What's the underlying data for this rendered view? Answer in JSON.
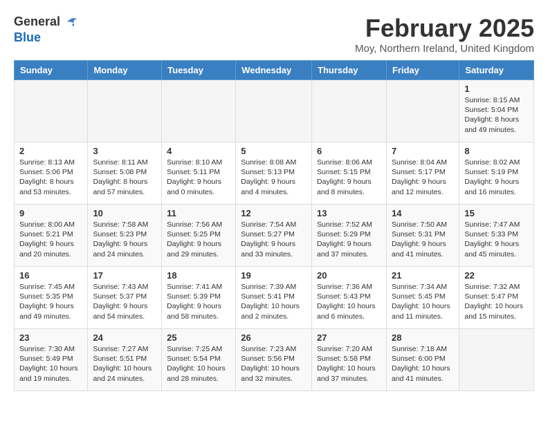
{
  "logo": {
    "general": "General",
    "blue": "Blue"
  },
  "title": "February 2025",
  "location": "Moy, Northern Ireland, United Kingdom",
  "days_of_week": [
    "Sunday",
    "Monday",
    "Tuesday",
    "Wednesday",
    "Thursday",
    "Friday",
    "Saturday"
  ],
  "weeks": [
    [
      {
        "day": "",
        "info": ""
      },
      {
        "day": "",
        "info": ""
      },
      {
        "day": "",
        "info": ""
      },
      {
        "day": "",
        "info": ""
      },
      {
        "day": "",
        "info": ""
      },
      {
        "day": "",
        "info": ""
      },
      {
        "day": "1",
        "info": "Sunrise: 8:15 AM\nSunset: 5:04 PM\nDaylight: 8 hours and 49 minutes."
      }
    ],
    [
      {
        "day": "2",
        "info": "Sunrise: 8:13 AM\nSunset: 5:06 PM\nDaylight: 8 hours and 53 minutes."
      },
      {
        "day": "3",
        "info": "Sunrise: 8:11 AM\nSunset: 5:08 PM\nDaylight: 8 hours and 57 minutes."
      },
      {
        "day": "4",
        "info": "Sunrise: 8:10 AM\nSunset: 5:11 PM\nDaylight: 9 hours and 0 minutes."
      },
      {
        "day": "5",
        "info": "Sunrise: 8:08 AM\nSunset: 5:13 PM\nDaylight: 9 hours and 4 minutes."
      },
      {
        "day": "6",
        "info": "Sunrise: 8:06 AM\nSunset: 5:15 PM\nDaylight: 9 hours and 8 minutes."
      },
      {
        "day": "7",
        "info": "Sunrise: 8:04 AM\nSunset: 5:17 PM\nDaylight: 9 hours and 12 minutes."
      },
      {
        "day": "8",
        "info": "Sunrise: 8:02 AM\nSunset: 5:19 PM\nDaylight: 9 hours and 16 minutes."
      }
    ],
    [
      {
        "day": "9",
        "info": "Sunrise: 8:00 AM\nSunset: 5:21 PM\nDaylight: 9 hours and 20 minutes."
      },
      {
        "day": "10",
        "info": "Sunrise: 7:58 AM\nSunset: 5:23 PM\nDaylight: 9 hours and 24 minutes."
      },
      {
        "day": "11",
        "info": "Sunrise: 7:56 AM\nSunset: 5:25 PM\nDaylight: 9 hours and 29 minutes."
      },
      {
        "day": "12",
        "info": "Sunrise: 7:54 AM\nSunset: 5:27 PM\nDaylight: 9 hours and 33 minutes."
      },
      {
        "day": "13",
        "info": "Sunrise: 7:52 AM\nSunset: 5:29 PM\nDaylight: 9 hours and 37 minutes."
      },
      {
        "day": "14",
        "info": "Sunrise: 7:50 AM\nSunset: 5:31 PM\nDaylight: 9 hours and 41 minutes."
      },
      {
        "day": "15",
        "info": "Sunrise: 7:47 AM\nSunset: 5:33 PM\nDaylight: 9 hours and 45 minutes."
      }
    ],
    [
      {
        "day": "16",
        "info": "Sunrise: 7:45 AM\nSunset: 5:35 PM\nDaylight: 9 hours and 49 minutes."
      },
      {
        "day": "17",
        "info": "Sunrise: 7:43 AM\nSunset: 5:37 PM\nDaylight: 9 hours and 54 minutes."
      },
      {
        "day": "18",
        "info": "Sunrise: 7:41 AM\nSunset: 5:39 PM\nDaylight: 9 hours and 58 minutes."
      },
      {
        "day": "19",
        "info": "Sunrise: 7:39 AM\nSunset: 5:41 PM\nDaylight: 10 hours and 2 minutes."
      },
      {
        "day": "20",
        "info": "Sunrise: 7:36 AM\nSunset: 5:43 PM\nDaylight: 10 hours and 6 minutes."
      },
      {
        "day": "21",
        "info": "Sunrise: 7:34 AM\nSunset: 5:45 PM\nDaylight: 10 hours and 11 minutes."
      },
      {
        "day": "22",
        "info": "Sunrise: 7:32 AM\nSunset: 5:47 PM\nDaylight: 10 hours and 15 minutes."
      }
    ],
    [
      {
        "day": "23",
        "info": "Sunrise: 7:30 AM\nSunset: 5:49 PM\nDaylight: 10 hours and 19 minutes."
      },
      {
        "day": "24",
        "info": "Sunrise: 7:27 AM\nSunset: 5:51 PM\nDaylight: 10 hours and 24 minutes."
      },
      {
        "day": "25",
        "info": "Sunrise: 7:25 AM\nSunset: 5:54 PM\nDaylight: 10 hours and 28 minutes."
      },
      {
        "day": "26",
        "info": "Sunrise: 7:23 AM\nSunset: 5:56 PM\nDaylight: 10 hours and 32 minutes."
      },
      {
        "day": "27",
        "info": "Sunrise: 7:20 AM\nSunset: 5:58 PM\nDaylight: 10 hours and 37 minutes."
      },
      {
        "day": "28",
        "info": "Sunrise: 7:18 AM\nSunset: 6:00 PM\nDaylight: 10 hours and 41 minutes."
      },
      {
        "day": "",
        "info": ""
      }
    ]
  ]
}
